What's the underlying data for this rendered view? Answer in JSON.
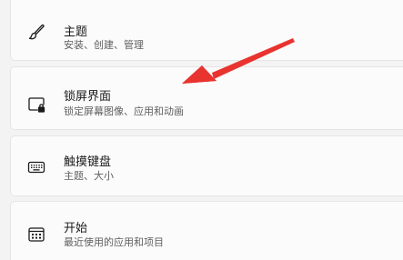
{
  "settings": {
    "items": [
      {
        "title": "主题",
        "subtitle": "安装、创建、管理",
        "icon": "brush-icon"
      },
      {
        "title": "锁屏界面",
        "subtitle": "锁定屏幕图像、应用和动画",
        "icon": "lock-screen-icon"
      },
      {
        "title": "触摸键盘",
        "subtitle": "主题、大小",
        "icon": "keyboard-icon"
      },
      {
        "title": "开始",
        "subtitle": "最近使用的应用和项目",
        "icon": "start-icon"
      }
    ]
  },
  "annotation": {
    "arrow_color": "#e8332f",
    "points_to": "锁屏界面"
  },
  "colors": {
    "background": "#f3f3f3",
    "card": "#fbfbfb",
    "title_text": "#1b1b1b",
    "subtitle_text": "#5f5f5f"
  }
}
